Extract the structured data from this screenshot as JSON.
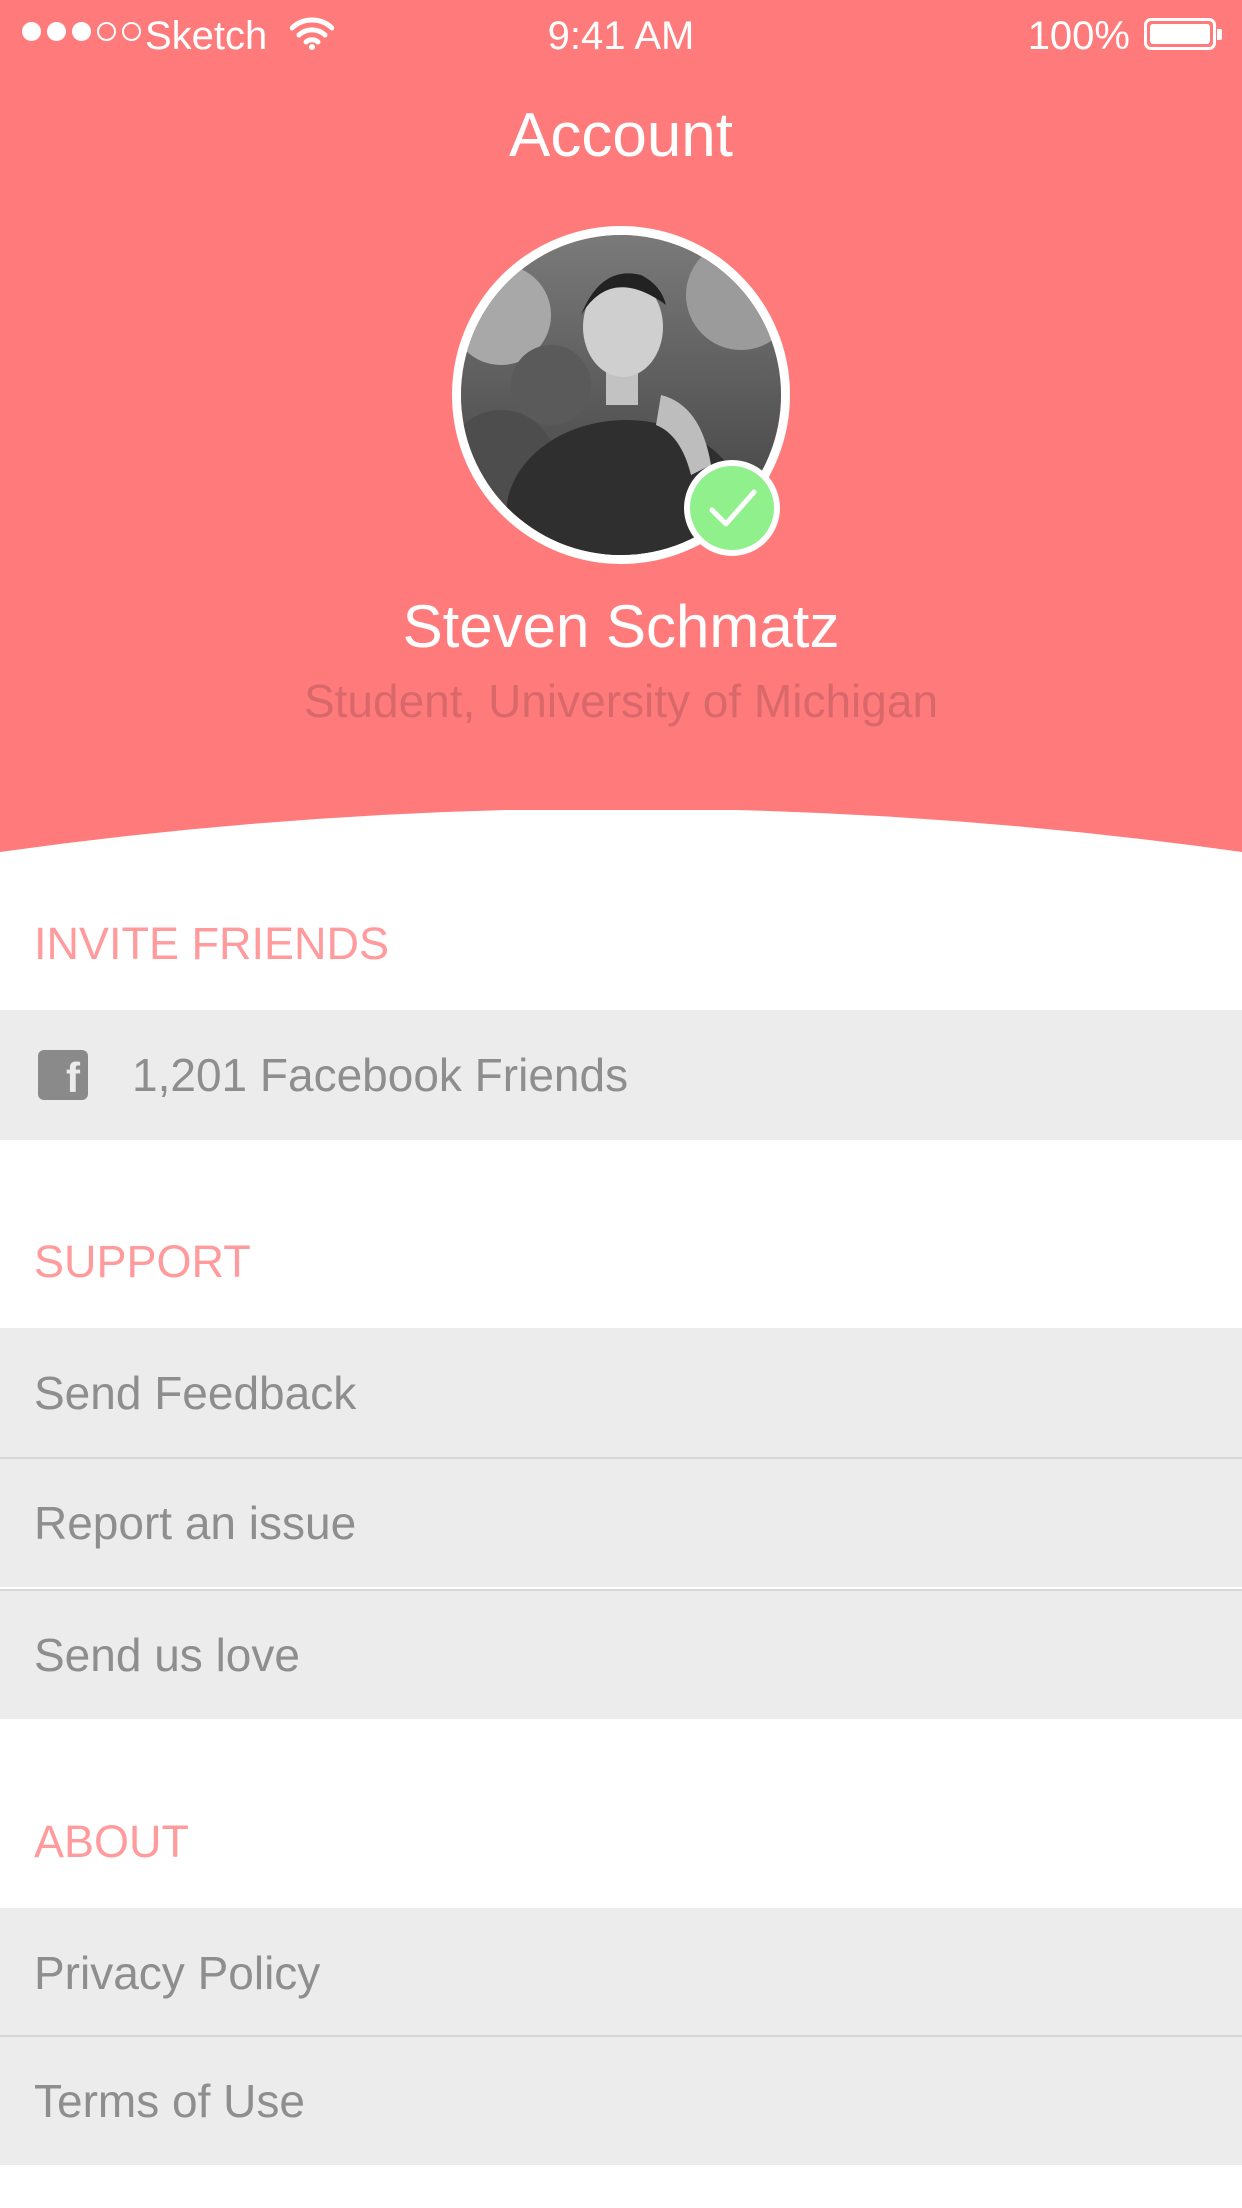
{
  "status_bar": {
    "carrier": "Sketch",
    "time": "9:41 AM",
    "battery": "100%",
    "signal_bars_filled": 3,
    "signal_bars_total": 5
  },
  "header": {
    "title": "Account",
    "name": "Steven Schmatz",
    "subtitle": "Student, University of Michigan",
    "verified": true,
    "background_color": "#ff7b7b"
  },
  "sections": {
    "invite": {
      "title": "INVITE FRIENDS",
      "items": [
        {
          "label": "1,201 Facebook Friends",
          "icon": "facebook-icon"
        }
      ]
    },
    "support": {
      "title": "SUPPORT",
      "items": [
        {
          "label": "Send Feedback"
        },
        {
          "label": "Report an issue"
        },
        {
          "label": "Send us love"
        }
      ]
    },
    "about": {
      "title": "ABOUT",
      "items": [
        {
          "label": "Privacy Policy"
        },
        {
          "label": "Terms of Use"
        }
      ]
    }
  },
  "colors": {
    "accent": "#ff7b7b",
    "section_title": "#ff9b9d",
    "row_background": "#ececec",
    "row_text": "#8e8e8e",
    "verified_badge": "#8ff08c"
  }
}
